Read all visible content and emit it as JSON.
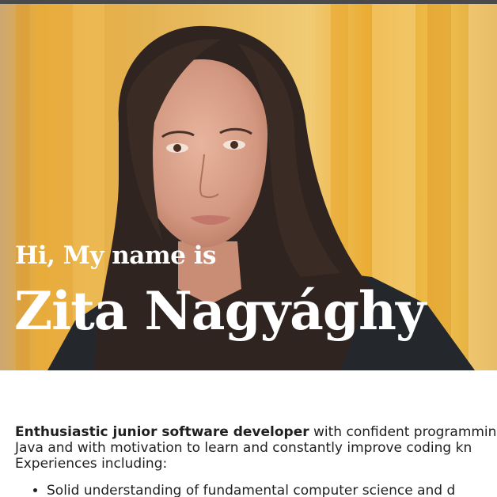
{
  "hero": {
    "greeting": "Hi, My name is",
    "name": "Zita Nagyághy",
    "photo_icon": "portrait-photo"
  },
  "intro": {
    "highlight": "Enthusiastic junior software developer",
    "line1_rest": " with confident programming",
    "line2": "Java and with motivation to learn and constantly improve coding kn",
    "line3": "Experiences including:"
  },
  "experiences": [
    "Solid understanding of fundamental computer science and d"
  ],
  "colors": {
    "background_curtain": "#e7b53c",
    "heading_text": "#ffffff",
    "body_text": "#1f1f1f"
  }
}
